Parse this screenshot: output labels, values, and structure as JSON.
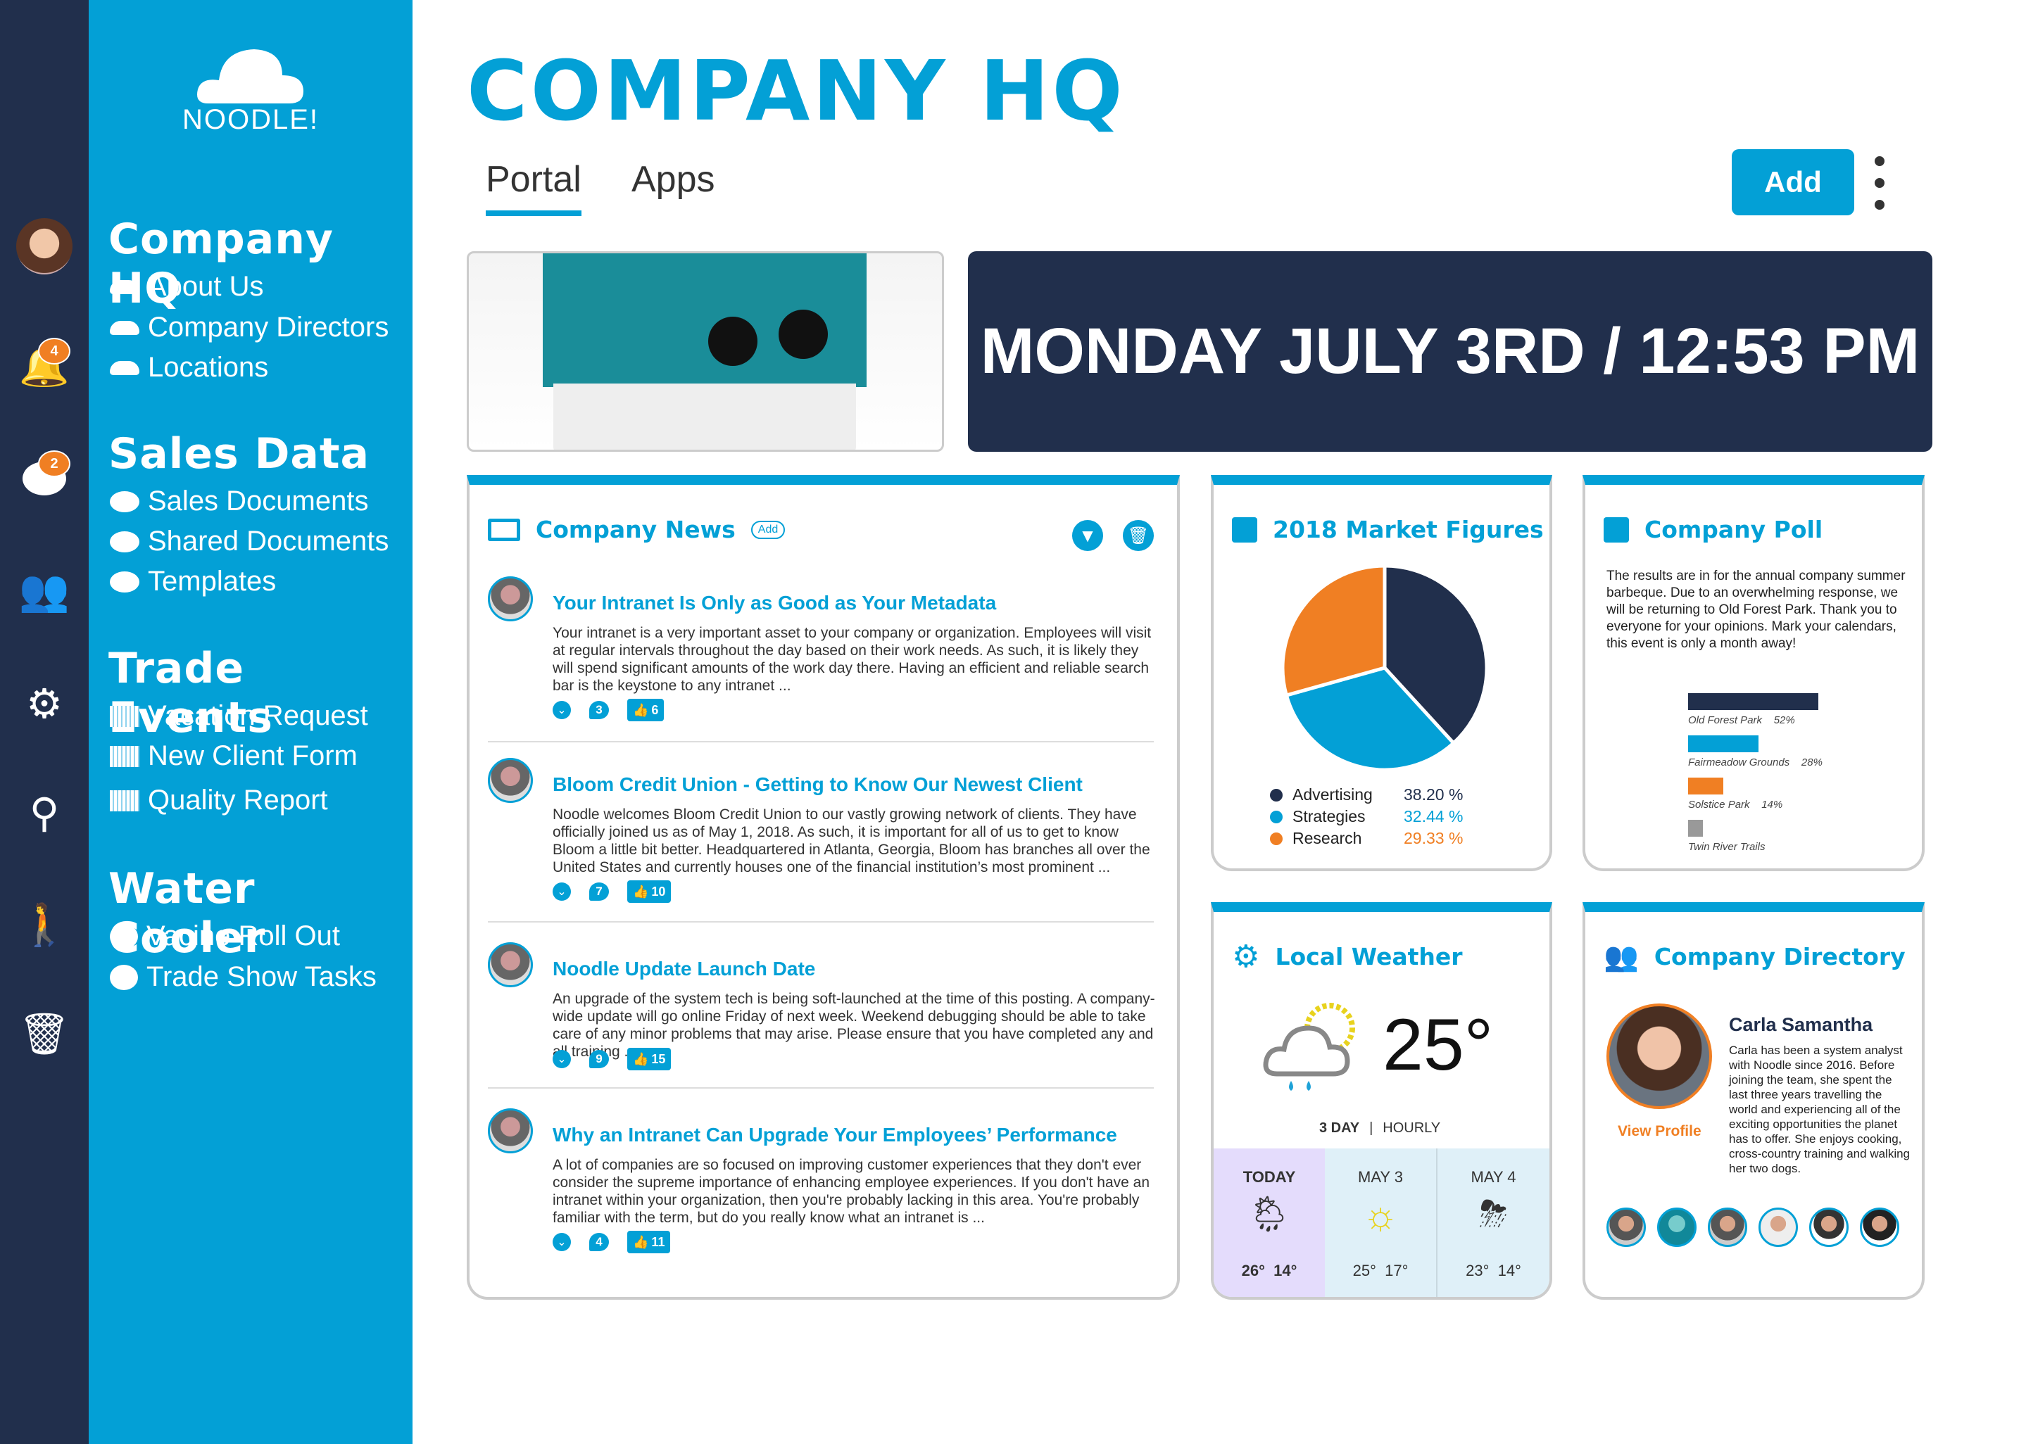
{
  "brand": {
    "name": "NOODLE!"
  },
  "rail": {
    "notifications_count": "4",
    "messages_count": "2",
    "icons": [
      "avatar",
      "bell-icon",
      "chat-icon",
      "users-icon",
      "gear-icon",
      "search-icon",
      "walk-icon",
      "trash-icon"
    ]
  },
  "sidebar": {
    "sections": [
      {
        "title": "Company HQ",
        "icon": "cloud-icon",
        "items": [
          "About Us",
          "Company Directors",
          "Locations"
        ]
      },
      {
        "title": "Sales Data",
        "icon": "document-icon",
        "items": [
          "Sales Documents",
          "Shared Documents",
          "Templates"
        ]
      },
      {
        "title": "Trade Events",
        "icon": "calendar-icon",
        "items": [
          "Vacation Request",
          "New Client Form",
          "Quality Report"
        ]
      },
      {
        "title": "Water Cooler",
        "icon": "stopwatch-icon",
        "items": [
          "Vacine Roll Out",
          "Trade Show Tasks"
        ]
      }
    ]
  },
  "header": {
    "title": "COMPANY HQ",
    "tabs": [
      "Portal",
      "Apps"
    ],
    "active_tab": "Portal",
    "add_label": "Add"
  },
  "datetime": "MONDAY JULY 3RD / 12:53 PM",
  "news": {
    "title": "Company News",
    "add_label": "Add",
    "items": [
      {
        "title": "Your Intranet Is Only as Good as Your Metadata",
        "body": "Your intranet is a very important asset to your company or organization. Employees will visit at regular intervals throughout the day based on their work needs. As such, it is likely they will spend significant amounts of the work day there. Having an efficient and reliable search bar is the keystone to any intranet ...",
        "comments": "3",
        "likes": "6"
      },
      {
        "title": "Bloom Credit Union - Getting to Know Our Newest Client",
        "body": "Noodle welcomes Bloom Credit Union to our vastly growing network of clients. They have officially joined us as of May 1, 2018. As such, it is important for all of us to get to know Bloom a little bit better. Headquartered in Atlanta, Georgia, Bloom has branches all over the United States and currently houses one of the financial institution’s most prominent ...",
        "comments": "7",
        "likes": "10"
      },
      {
        "title": "Noodle Update Launch Date",
        "body": "An upgrade of the system tech is being soft-launched at the time of this posting. A company-wide update will go online Friday of next week. Weekend debugging should be able to take care of any minor problems that may arise. Please ensure that you have completed any and all training ...",
        "comments": "9",
        "likes": "15"
      },
      {
        "title": "Why an Intranet Can Upgrade Your Employees’ Performance",
        "body": "A lot of companies are so focused on improving customer experiences that they don't ever consider the supreme importance of enhancing employee experiences. If you don't have an intranet within your organization, then you're probably lacking in this area. You're probably familiar with the term, but do you really know what an intranet is ...",
        "comments": "4",
        "likes": "11"
      }
    ]
  },
  "market": {
    "title": "2018 Market Figures"
  },
  "chart_data": [
    {
      "type": "pie",
      "title": "2018 Market Figures",
      "series": [
        {
          "name": "Advertising",
          "value": 38.2,
          "label": "38.20 %",
          "color": "#212f4c"
        },
        {
          "name": "Strategies",
          "value": 32.44,
          "label": "32.44 %",
          "color": "#03a0d6"
        },
        {
          "name": "Research",
          "value": 29.33,
          "label": "29.33 %",
          "color": "#f07f23"
        }
      ]
    },
    {
      "type": "bar",
      "title": "Company Poll",
      "categories": [
        "Old Forest Park",
        "Fairmeadow Grounds",
        "Solstice Park",
        "Twin River Trails"
      ],
      "values": [
        52,
        28,
        14,
        6
      ],
      "labels": [
        "52%",
        "28%",
        "14%",
        ""
      ],
      "colors": [
        "#212f4c",
        "#03a0d6",
        "#f07f23",
        "#999999"
      ]
    }
  ],
  "poll": {
    "title": "Company Poll",
    "body": "The results are in for the annual company summer barbeque. Due to an overwhelming response, we will be returning to Old Forest Park. Thank you to everyone for your opinions. Mark your calendars, this event is only a month away!"
  },
  "weather": {
    "title": "Local Weather",
    "current_temp": "25°",
    "current_icon": "cloud-sun-rain-icon",
    "toggle": [
      "3 DAY",
      "HOURLY"
    ],
    "days": [
      {
        "label": "TODAY",
        "high": "26°",
        "low": "14°",
        "icon": "cloud-sun-rain-icon"
      },
      {
        "label": "MAY 3",
        "high": "25°",
        "low": "17°",
        "icon": "sun-icon"
      },
      {
        "label": "MAY 4",
        "high": "23°",
        "low": "14°",
        "icon": "cloud-sun-storm-icon"
      }
    ]
  },
  "directory": {
    "title": "Company Directory",
    "name": "Carla Samantha",
    "bio": "Carla has been a system analyst with Noodle since 2016. Before joining the team, she spent the last three years travelling the world and experiencing all of the exciting opportunities the planet has to offer. She enjoys cooking, cross-country training and walking her two dogs.",
    "view_profile": "View Profile"
  }
}
